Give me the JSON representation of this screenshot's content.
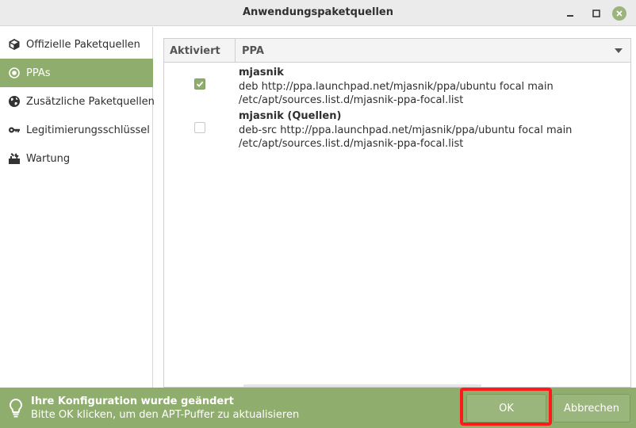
{
  "window": {
    "title": "Anwendungspaketquellen"
  },
  "sidebar": {
    "items": [
      {
        "label": "Offizielle Paketquellen",
        "icon": "package-icon",
        "active": false
      },
      {
        "label": "PPAs",
        "icon": "radio-icon",
        "active": true
      },
      {
        "label": "Zusätzliche Paketquellen",
        "icon": "globe-icon",
        "active": false
      },
      {
        "label": "Legitimierungsschlüssel",
        "icon": "key-icon",
        "active": false
      },
      {
        "label": "Wartung",
        "icon": "tools-icon",
        "active": false
      }
    ]
  },
  "table": {
    "columns": [
      "Aktiviert",
      "PPA"
    ],
    "rows": [
      {
        "enabled": true,
        "name": "mjasnik",
        "line": "deb http://ppa.launchpad.net/mjasnik/ppa/ubuntu focal main",
        "file": "/etc/apt/sources.list.d/mjasnik-ppa-focal.list"
      },
      {
        "enabled": false,
        "name": "mjasnik (Quellen)",
        "line": "deb-src http://ppa.launchpad.net/mjasnik/ppa/ubuntu focal main",
        "file": "/etc/apt/sources.list.d/mjasnik-ppa-focal.list"
      }
    ]
  },
  "infobar": {
    "title": "Ihre Konfiguration wurde geändert",
    "message": "Bitte OK klicken, um den APT-Puffer zu aktualisieren",
    "ok_label": "OK",
    "cancel_label": "Abbrechen"
  },
  "colors": {
    "accent": "#8fad6c",
    "highlight": "#ff1a1a"
  }
}
